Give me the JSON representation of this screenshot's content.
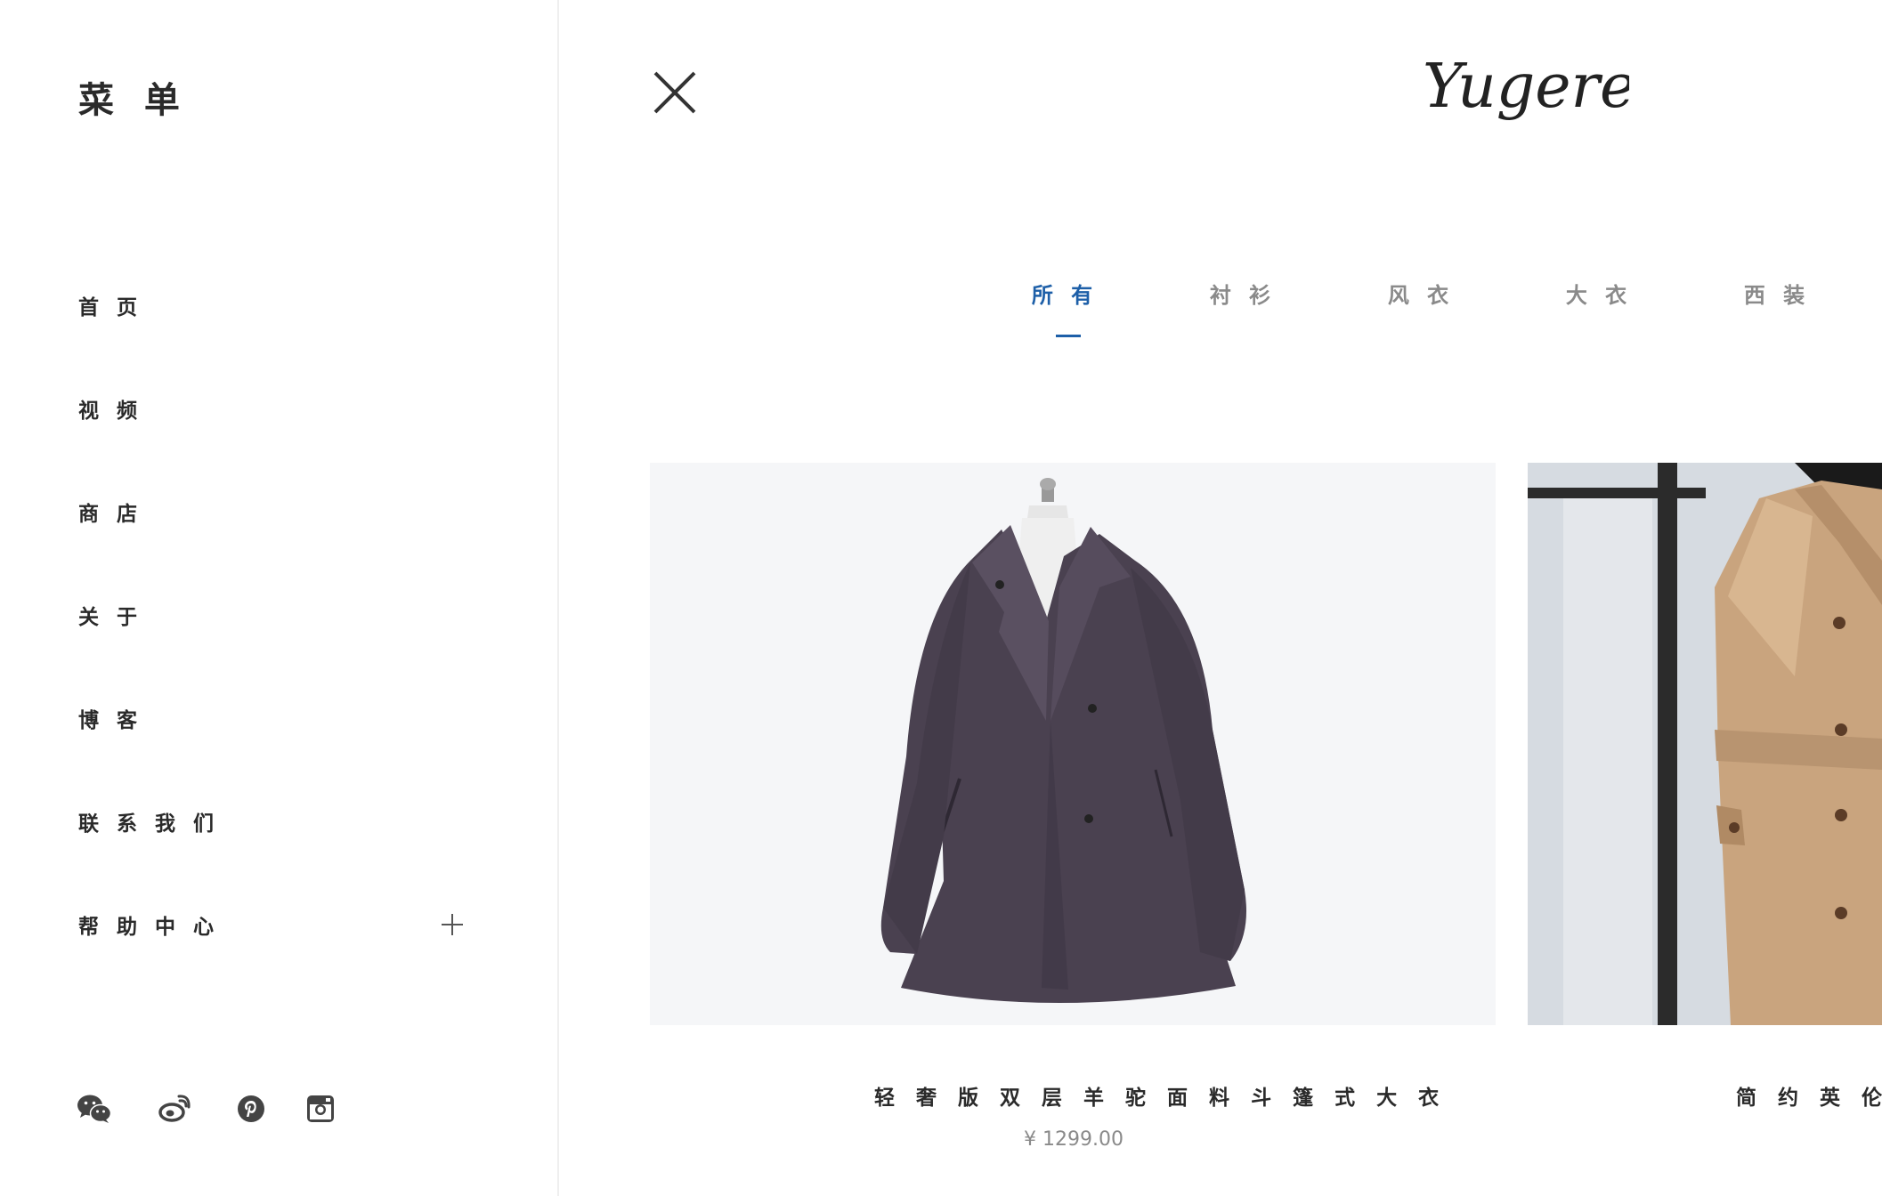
{
  "sidebar": {
    "title": "菜 单",
    "items": [
      {
        "label": "首 页"
      },
      {
        "label": "视 频"
      },
      {
        "label": "商 店"
      },
      {
        "label": "关 于"
      },
      {
        "label": "博 客"
      },
      {
        "label": "联 系 我 们"
      },
      {
        "label": "帮 助 中 心",
        "expandable": true,
        "icon": "plus-icon"
      }
    ],
    "social": [
      {
        "icon": "wechat-icon"
      },
      {
        "icon": "weibo-icon"
      },
      {
        "icon": "pinterest-icon"
      },
      {
        "icon": "instagram-icon"
      }
    ]
  },
  "header": {
    "close_icon": "close-icon",
    "logo_text": "Yugere"
  },
  "tabs": [
    {
      "label": "所 有",
      "active": true
    },
    {
      "label": "衬 衫",
      "active": false
    },
    {
      "label": "风 衣",
      "active": false
    },
    {
      "label": "大 衣",
      "active": false
    },
    {
      "label": "西 装",
      "active": false
    }
  ],
  "products": [
    {
      "name": "轻 奢 版 双 层 羊 驼 面 料 斗 篷 式 大 衣",
      "price": "¥ 1299.00"
    },
    {
      "name": "简 约 英 伦 风"
    }
  ],
  "colors": {
    "accent": "#1d5fa8",
    "text": "#2a2a2a",
    "muted": "#8a8a8a",
    "divider": "#efefef"
  }
}
